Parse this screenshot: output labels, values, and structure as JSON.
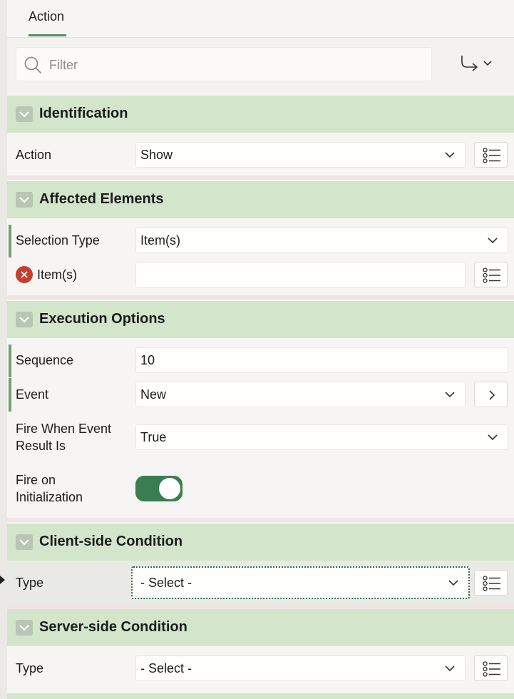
{
  "tabs": [
    {
      "label": "Action",
      "active": true
    }
  ],
  "filter": {
    "placeholder": "Filter",
    "value": ""
  },
  "sections": {
    "identification": {
      "title": "Identification",
      "action": {
        "label": "Action",
        "value": "Show"
      }
    },
    "affected": {
      "title": "Affected Elements",
      "selection_type": {
        "label": "Selection Type",
        "value": "Item(s)"
      },
      "items": {
        "label": "Item(s)",
        "value": ""
      }
    },
    "execution": {
      "title": "Execution Options",
      "sequence": {
        "label": "Sequence",
        "value": "10"
      },
      "event": {
        "label": "Event",
        "value": "New"
      },
      "fire_when": {
        "label_line1": "Fire When Event",
        "label_line2": "Result Is",
        "value": "True"
      },
      "fire_on_init": {
        "label_line1": "Fire on",
        "label_line2": "Initialization",
        "on": true
      }
    },
    "client_condition": {
      "title": "Client-side Condition",
      "type": {
        "label": "Type",
        "value": "- Select -"
      }
    },
    "server_condition": {
      "title": "Server-side Condition",
      "type": {
        "label": "Type",
        "value": "- Select -"
      }
    }
  },
  "colors": {
    "section_header": "#d3e5cb",
    "toggle_on": "#3a7d53",
    "error": "#c83d2e",
    "required_bar": "#7b9c7b"
  }
}
